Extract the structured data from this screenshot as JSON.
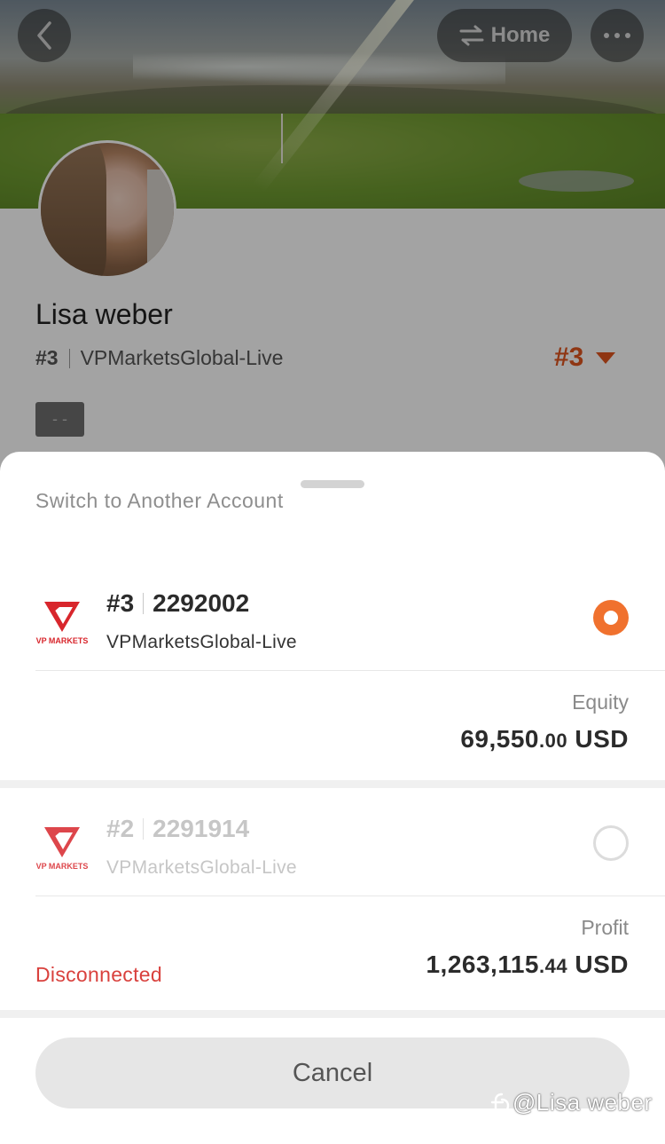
{
  "header": {
    "home_label": "Home",
    "back_icon": "chevron-left-icon",
    "switch_icon": "swap-arrows-icon",
    "more_icon": "more-dots-icon"
  },
  "profile": {
    "name": "Lisa weber",
    "account_number": "#3",
    "server": "VPMarketsGlobal-Live",
    "rank": "#3",
    "tag": "- -"
  },
  "sheet": {
    "title": "Switch to Another Account",
    "accounts": [
      {
        "number": "#3",
        "login": "2292002",
        "server": "VPMarketsGlobal-Live",
        "logo_text": "VP MARKETS",
        "selected": true,
        "metric_label": "Equity",
        "metric_int": "69,550",
        "metric_dec": ".00",
        "metric_currency": " USD",
        "status": ""
      },
      {
        "number": "#2",
        "login": "2291914",
        "server": "VPMarketsGlobal-Live",
        "logo_text": "VP MARKETS",
        "selected": false,
        "metric_label": "Profit",
        "metric_int": "1,263,115",
        "metric_dec": ".44",
        "metric_currency": " USD",
        "status": "Disconnected"
      }
    ],
    "cancel_label": "Cancel"
  },
  "watermark": "@Lisa weber",
  "colors": {
    "accent": "#f0712e",
    "rank": "#e0551f",
    "error": "#d9413d",
    "brand_red": "#d8262c"
  }
}
